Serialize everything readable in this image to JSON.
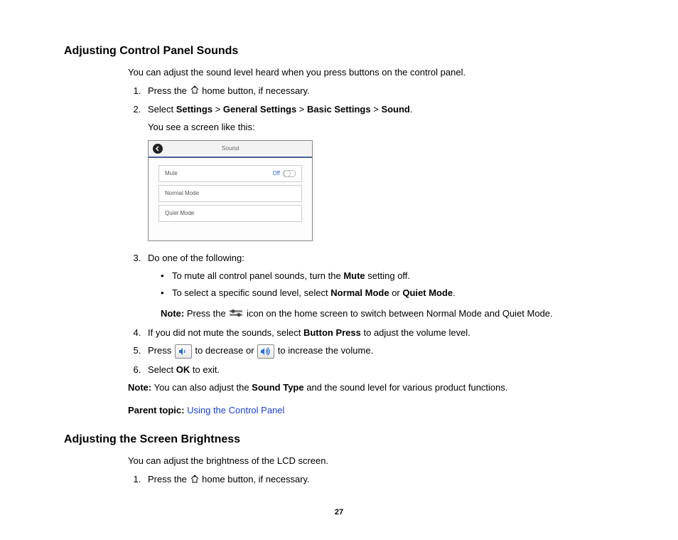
{
  "section1": {
    "heading": "Adjusting Control Panel Sounds",
    "intro": "You can adjust the sound level heard when you press buttons on the control panel.",
    "step1_a": "Press the ",
    "step1_b": " home button, if necessary.",
    "step2_a": "Select ",
    "step2_settings": "Settings",
    "step2_gt": " > ",
    "step2_general": "General Settings",
    "step2_basic": "Basic Settings",
    "step2_sound": "Sound",
    "step2_period": ".",
    "step2_sub": "You see a screen like this:",
    "screenshot": {
      "title": "Sound",
      "row1_label": "Mute",
      "row1_state": "Off",
      "row2_label": "Normal Mode",
      "row3_label": "Quiet Mode"
    },
    "step3": "Do one of the following:",
    "step3_b1_a": "To mute all control panel sounds, turn the ",
    "step3_b1_bold": "Mute",
    "step3_b1_b": " setting off.",
    "step3_b2_a": "To select a specific sound level, select ",
    "step3_b2_bold1": "Normal Mode",
    "step3_b2_mid": " or ",
    "step3_b2_bold2": "Quiet Mode",
    "step3_b2_end": ".",
    "note1_label": "Note:",
    "note1_a": " Press the ",
    "note1_b": " icon on the home screen to switch between Normal Mode and Quiet Mode.",
    "step4_a": "If you did not mute the sounds, select ",
    "step4_bold": "Button Press",
    "step4_b": " to adjust the volume level.",
    "step5_a": "Press ",
    "step5_mid": " to decrease or ",
    "step5_b": " to increase the volume.",
    "step6_a": "Select ",
    "step6_bold": "OK",
    "step6_b": " to exit.",
    "note2_label": "Note:",
    "note2_a": " You can also adjust the ",
    "note2_bold": "Sound Type",
    "note2_b": " and the sound level for various product functions.",
    "parent_label": "Parent topic:",
    "parent_link": "Using the Control Panel"
  },
  "section2": {
    "heading": "Adjusting the Screen Brightness",
    "intro": "You can adjust the brightness of the LCD screen.",
    "step1_a": "Press the ",
    "step1_b": " home button, if necessary."
  },
  "pagenum": "27"
}
